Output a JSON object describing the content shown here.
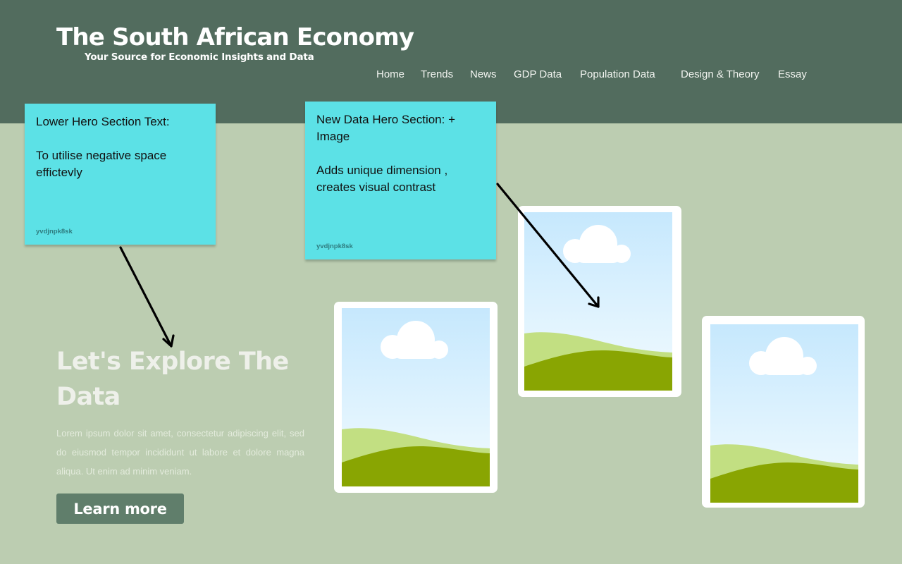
{
  "header": {
    "title": "The South African Economy",
    "tagline": "Your Source for Economic Insights and Data",
    "nav": [
      {
        "label": "Home"
      },
      {
        "label": "Trends"
      },
      {
        "label": "News"
      },
      {
        "label": "GDP Data"
      },
      {
        "label": "Population Data"
      },
      {
        "label": "Design & Theory"
      },
      {
        "label": "Essay"
      }
    ]
  },
  "sticky_notes": [
    {
      "text": "Lower Hero Section Text:\n\nTo utilise negative space effictevly",
      "author": "yvdjnpk8sk"
    },
    {
      "text": "New Data Hero Section: + Image\n\nAdds unique dimension , creates visual contrast",
      "author": "yvdjnpk8sk"
    }
  ],
  "hero": {
    "heading": "Let's Explore The Data",
    "body": "Lorem ipsum dolor sit amet, consectetur adipiscing elit, sed do eiusmod tempor incididunt ut labore et dolore magna aliqua. Ut enim ad minim veniam.",
    "button_label": "Learn more"
  },
  "images": [
    {
      "icon": "landscape-placeholder-icon"
    },
    {
      "icon": "landscape-placeholder-icon"
    },
    {
      "icon": "landscape-placeholder-icon"
    }
  ],
  "colors": {
    "header_bg": "#526c5e",
    "page_bg": "#bccdb1",
    "sticky_note": "#5ce1e6",
    "button_bg": "#607e6b",
    "hill_dark": "#89a502",
    "hill_light": "#c2df82"
  }
}
